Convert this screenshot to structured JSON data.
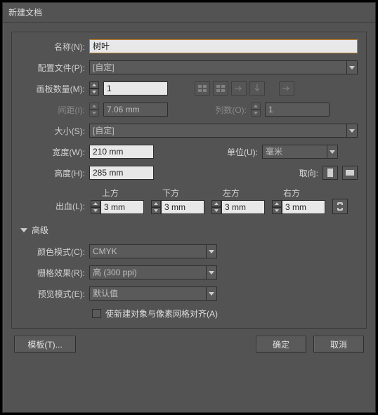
{
  "window": {
    "title": "新建文档"
  },
  "name": {
    "label": "名称(N):",
    "value": "树叶"
  },
  "profile": {
    "label": "配置文件(P):",
    "value": "[自定]"
  },
  "artboards": {
    "count_label": "画板数量(M):",
    "count": "1",
    "spacing_label": "间距(I):",
    "spacing": "7.06 mm",
    "cols_label": "列数(O):",
    "cols": "1"
  },
  "size": {
    "label": "大小(S):",
    "value": "[自定]"
  },
  "width": {
    "label": "宽度(W):",
    "value": "210 mm"
  },
  "height": {
    "label": "高度(H):",
    "value": "285 mm"
  },
  "units": {
    "label": "单位(U):",
    "value": "毫米"
  },
  "orientation": {
    "label": "取向:"
  },
  "bleed": {
    "label": "出血(L):",
    "top_label": "上方",
    "bottom_label": "下方",
    "left_label": "左方",
    "right_label": "右方",
    "top": "3 mm",
    "bottom": "3 mm",
    "left": "3 mm",
    "right": "3 mm"
  },
  "advanced": {
    "label": "高级"
  },
  "colorMode": {
    "label": "颜色模式(C):",
    "value": "CMYK"
  },
  "raster": {
    "label": "栅格效果(R):",
    "value": "高 (300 ppi)"
  },
  "preview": {
    "label": "预览模式(E):",
    "value": "默认值"
  },
  "alignPixel": {
    "label": "使新建对象与像素网格对齐(A)"
  },
  "buttons": {
    "template": "模板(T)...",
    "ok": "确定",
    "cancel": "取消"
  }
}
